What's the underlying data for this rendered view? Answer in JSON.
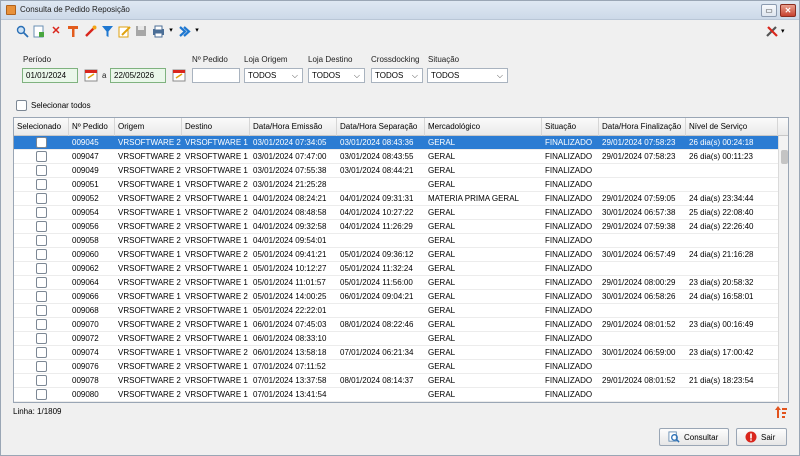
{
  "window": {
    "title": "Consulta de Pedido Reposição"
  },
  "filters": {
    "periodo_label": "Período",
    "date_from": "01/01/2024",
    "date_sep": "a",
    "date_to": "22/05/2026",
    "pedido_label": "Nº Pedido",
    "pedido_value": "",
    "loja_origem_label": "Loja Origem",
    "loja_origem_value": "TODOS",
    "loja_destino_label": "Loja Destino",
    "loja_destino_value": "TODOS",
    "crossdocking_label": "Crossdocking",
    "crossdocking_value": "TODOS",
    "situacao_label": "Situação",
    "situacao_value": "TODOS"
  },
  "select_all_label": "Selecionar todos",
  "table": {
    "columns": [
      "Selecionado",
      "Nº Pedido",
      "Origem",
      "Destino",
      "Data/Hora Emissão",
      "Data/Hora Separação",
      "Mercadológico",
      "Situação",
      "Data/Hora Finalização",
      "Nível de Serviço"
    ],
    "rows": [
      [
        "",
        "009045",
        "VRSOFTWARE 2",
        "VRSOFTWARE 1",
        "03/01/2024 07:34:05",
        "03/01/2024 08:43:36",
        "GERAL",
        "FINALIZADO",
        "29/01/2024 07:58:23",
        "26 dia(s) 00:24:18"
      ],
      [
        "",
        "009047",
        "VRSOFTWARE 2",
        "VRSOFTWARE 1",
        "03/01/2024 07:47:00",
        "03/01/2024 08:43:55",
        "GERAL",
        "FINALIZADO",
        "29/01/2024 07:58:23",
        "26 dia(s) 00:11:23"
      ],
      [
        "",
        "009049",
        "VRSOFTWARE 2",
        "VRSOFTWARE 1",
        "03/01/2024 07:55:38",
        "03/01/2024 08:44:21",
        "GERAL",
        "FINALIZADO",
        "",
        ""
      ],
      [
        "",
        "009051",
        "VRSOFTWARE 1",
        "VRSOFTWARE 2",
        "03/01/2024 21:25:28",
        "",
        "GERAL",
        "FINALIZADO",
        "",
        ""
      ],
      [
        "",
        "009052",
        "VRSOFTWARE 2",
        "VRSOFTWARE 1",
        "04/01/2024 08:24:21",
        "04/01/2024 09:31:31",
        "MATERIA PRIMA GERAL",
        "FINALIZADO",
        "29/01/2024 07:59:05",
        "24 dia(s) 23:34:44"
      ],
      [
        "",
        "009054",
        "VRSOFTWARE 1",
        "VRSOFTWARE 2",
        "04/01/2024 08:48:58",
        "04/01/2024 10:27:22",
        "GERAL",
        "FINALIZADO",
        "30/01/2024 06:57:38",
        "25 dia(s) 22:08:40"
      ],
      [
        "",
        "009056",
        "VRSOFTWARE 2",
        "VRSOFTWARE 1",
        "04/01/2024 09:32:58",
        "04/01/2024 11:26:29",
        "GERAL",
        "FINALIZADO",
        "29/01/2024 07:59:38",
        "24 dia(s) 22:26:40"
      ],
      [
        "",
        "009058",
        "VRSOFTWARE 2",
        "VRSOFTWARE 1",
        "04/01/2024 09:54:01",
        "",
        "GERAL",
        "FINALIZADO",
        "",
        ""
      ],
      [
        "",
        "009060",
        "VRSOFTWARE 1",
        "VRSOFTWARE 2",
        "05/01/2024 09:41:21",
        "05/01/2024 09:36:12",
        "GERAL",
        "FINALIZADO",
        "30/01/2024 06:57:49",
        "24 dia(s) 21:16:28"
      ],
      [
        "",
        "009062",
        "VRSOFTWARE 2",
        "VRSOFTWARE 1",
        "05/01/2024 10:12:27",
        "05/01/2024 11:32:24",
        "GERAL",
        "FINALIZADO",
        "",
        ""
      ],
      [
        "",
        "009064",
        "VRSOFTWARE 2",
        "VRSOFTWARE 1",
        "05/01/2024 11:01:57",
        "05/01/2024 11:56:00",
        "GERAL",
        "FINALIZADO",
        "29/01/2024 08:00:29",
        "23 dia(s) 20:58:32"
      ],
      [
        "",
        "009066",
        "VRSOFTWARE 1",
        "VRSOFTWARE 2",
        "05/01/2024 14:00:25",
        "06/01/2024 09:04:21",
        "GERAL",
        "FINALIZADO",
        "30/01/2024 06:58:26",
        "24 dia(s) 16:58:01"
      ],
      [
        "",
        "009068",
        "VRSOFTWARE 2",
        "VRSOFTWARE 1",
        "05/01/2024 22:22:01",
        "",
        "GERAL",
        "FINALIZADO",
        "",
        ""
      ],
      [
        "",
        "009070",
        "VRSOFTWARE 2",
        "VRSOFTWARE 1",
        "06/01/2024 07:45:03",
        "08/01/2024 08:22:46",
        "GERAL",
        "FINALIZADO",
        "29/01/2024 08:01:52",
        "23 dia(s) 00:16:49"
      ],
      [
        "",
        "009072",
        "VRSOFTWARE 2",
        "VRSOFTWARE 1",
        "06/01/2024 08:33:10",
        "",
        "GERAL",
        "FINALIZADO",
        "",
        ""
      ],
      [
        "",
        "009074",
        "VRSOFTWARE 1",
        "VRSOFTWARE 2",
        "06/01/2024 13:58:18",
        "07/01/2024 06:21:34",
        "GERAL",
        "FINALIZADO",
        "30/01/2024 06:59:00",
        "23 dia(s) 17:00:42"
      ],
      [
        "",
        "009076",
        "VRSOFTWARE 2",
        "VRSOFTWARE 1",
        "07/01/2024 07:11:52",
        "",
        "GERAL",
        "FINALIZADO",
        "",
        ""
      ],
      [
        "",
        "009078",
        "VRSOFTWARE 2",
        "VRSOFTWARE 1",
        "07/01/2024 13:37:58",
        "08/01/2024 08:14:37",
        "GERAL",
        "FINALIZADO",
        "29/01/2024 08:01:52",
        "21 dia(s) 18:23:54"
      ],
      [
        "",
        "009080",
        "VRSOFTWARE 2",
        "VRSOFTWARE 1",
        "07/01/2024 13:41:54",
        "",
        "GERAL",
        "FINALIZADO",
        "",
        ""
      ]
    ],
    "selected_row_index": 0
  },
  "status": {
    "line_text": "Linha: 1/1809"
  },
  "buttons": {
    "consultar": "Consultar",
    "sair": "Sair"
  },
  "colors": {
    "selection": "#2b7cd3",
    "accent_red": "#d9261c",
    "date_bg": "#eaf7ea"
  },
  "icons": [
    "search-icon",
    "new-document-icon",
    "delete-icon",
    "tools-icon",
    "wrench-icon",
    "filter-icon",
    "edit-icon",
    "save-icon",
    "print-icon",
    "forward-icon",
    "settings-icon"
  ]
}
